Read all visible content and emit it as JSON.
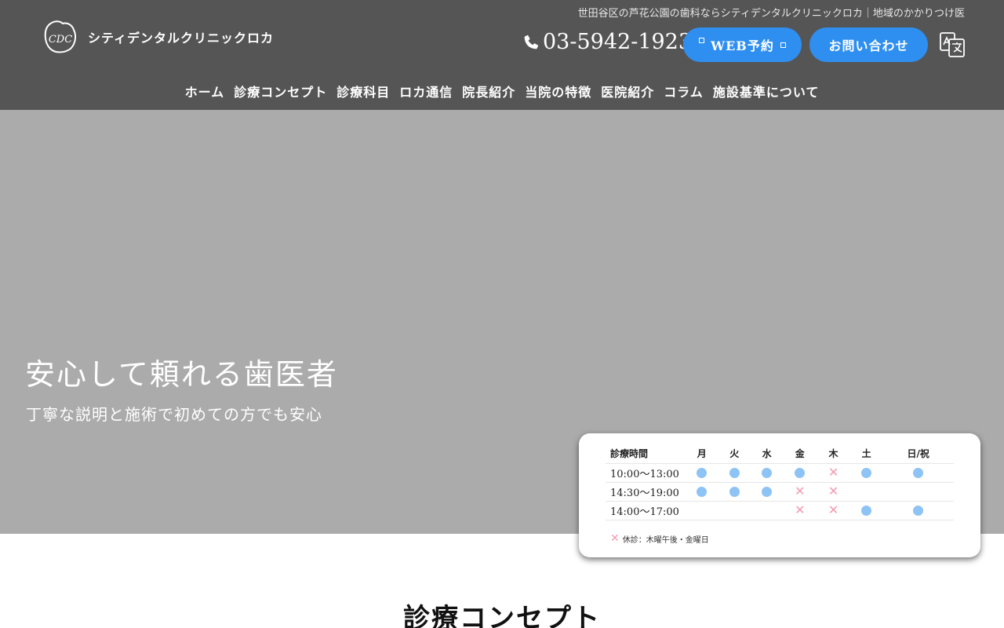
{
  "header": {
    "tagline": "世田谷区の芦花公園の歯科ならシティデンタルクリニックロカ｜地域のかかりつけ医",
    "logo_text": "シティデンタルクリニックロカ",
    "logo_mark_text": "CDC",
    "phone_icon": "phone-icon",
    "phone_number": "03-5942-1923",
    "web_button_label": "WEB予約",
    "contact_button_label": "お問い合わせ",
    "translate_icon": "translate-icon",
    "background_color": "#555555",
    "button_color": "#2f8ff0"
  },
  "nav": {
    "items": [
      {
        "label": "ホーム"
      },
      {
        "label": "診療コンセプト"
      },
      {
        "label": "診療科目"
      },
      {
        "label": "ロカ通信"
      },
      {
        "label": "院長紹介"
      },
      {
        "label": "当院の特徴"
      },
      {
        "label": "医院紹介"
      },
      {
        "label": "コラム"
      },
      {
        "label": "施設基準について"
      }
    ]
  },
  "hero": {
    "title": "安心して頼れる歯医者",
    "subtitle": "丁寧な説明と施術で初めての方でも安心",
    "background_color": "#ababab"
  },
  "schedule": {
    "header": [
      "診療時間",
      "月",
      "火",
      "水",
      "金",
      "木",
      "土",
      "日/祝"
    ],
    "rows": [
      {
        "time": "10:00～13:00",
        "marks": [
          "open",
          "open",
          "open",
          "open",
          "closed",
          "open",
          "open"
        ]
      },
      {
        "time": "14:30～19:00",
        "marks": [
          "open",
          "open",
          "open",
          "closed",
          "closed",
          "",
          ""
        ]
      },
      {
        "time": "14:00～17:00",
        "marks": [
          "",
          "",
          "",
          "closed",
          "closed",
          "open",
          "open"
        ]
      }
    ],
    "note": "休診：木曜午後・金曜日",
    "open_color": "#8ec3f5",
    "closed_color": "#f39ab0"
  },
  "section": {
    "title": "診療コンセプト"
  }
}
